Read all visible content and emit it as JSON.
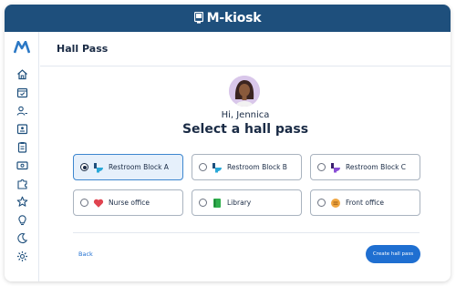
{
  "app": {
    "brand": "M-kiosk"
  },
  "sidebar": {
    "items": [
      {
        "icon": "home-icon"
      },
      {
        "icon": "calendar-icon"
      },
      {
        "icon": "users-icon"
      },
      {
        "icon": "id-card-icon"
      },
      {
        "icon": "clipboard-icon"
      },
      {
        "icon": "ticket-icon"
      },
      {
        "icon": "puzzle-icon"
      },
      {
        "icon": "star-icon"
      },
      {
        "icon": "lightbulb-icon"
      },
      {
        "icon": "moon-icon"
      },
      {
        "icon": "settings-icon"
      }
    ]
  },
  "header": {
    "title": "Hall Pass"
  },
  "main": {
    "greeting": "Hi, Jennica",
    "heading": "Select a hall pass",
    "options": [
      {
        "label": "Restroom Block A",
        "icon": "toilet-icon",
        "selected": true
      },
      {
        "label": "Restroom Block B",
        "icon": "toilet-icon",
        "selected": false
      },
      {
        "label": "Restroom Block C",
        "icon": "toilet-icon",
        "selected": false
      },
      {
        "label": "Nurse office",
        "icon": "heart-icon",
        "selected": false
      },
      {
        "label": "Library",
        "icon": "book-icon",
        "selected": false
      },
      {
        "label": "Front office",
        "icon": "office-icon",
        "selected": false
      }
    ],
    "back_label": "Back",
    "create_label": "Create hall pass"
  },
  "colors": {
    "topbar": "#1e4f7c",
    "primary": "#1f6fd1",
    "selected_bg": "#e6f0fb",
    "selected_border": "#3d86cf",
    "text_dark": "#1a2b45"
  }
}
